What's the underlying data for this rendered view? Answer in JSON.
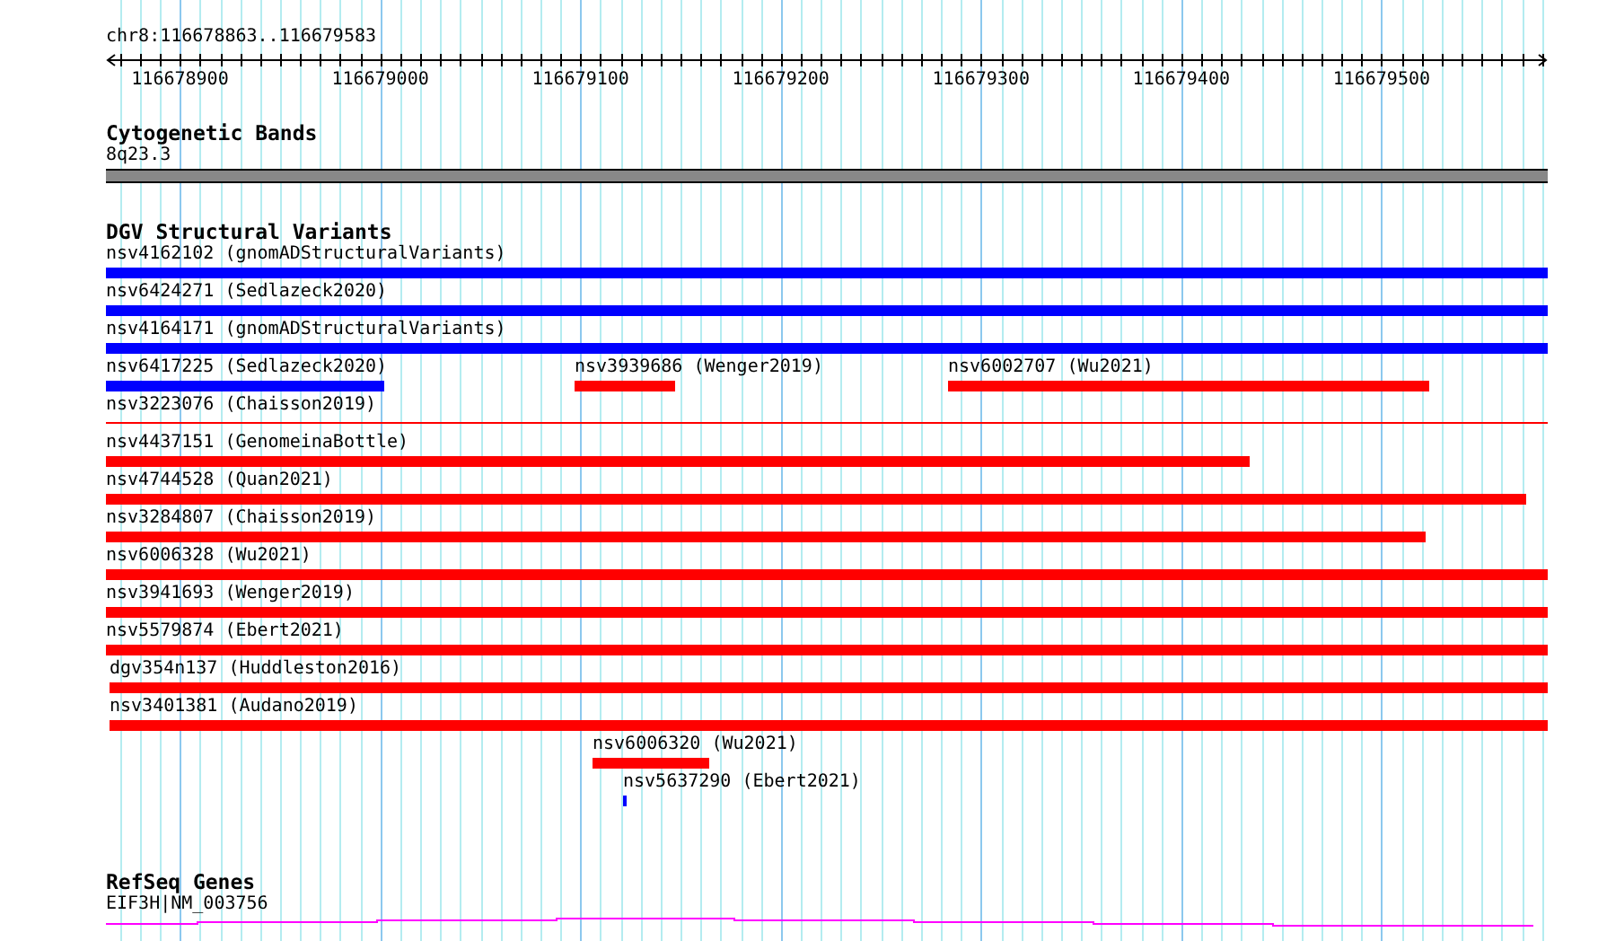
{
  "location": "chr8:116678863..116679583",
  "ruler": {
    "ticks": [
      "116678900",
      "116679000",
      "116679100",
      "116679200",
      "116679300",
      "116679400",
      "116679500"
    ]
  },
  "tracks": [
    {
      "kind": "bands",
      "title": "Cytogenetic Bands",
      "label": "8q23.3"
    },
    {
      "kind": "variants",
      "title": "DGV Structural Variants",
      "rows": [
        {
          "features": [
            {
              "kind": "bar",
              "label": "nsv4162102 (gnomADStructuralVariants)",
              "color": "#0000ff"
            }
          ]
        },
        {
          "features": [
            {
              "kind": "bar",
              "label": "nsv6424271 (Sedlazeck2020)",
              "color": "#0000ff"
            }
          ]
        },
        {
          "features": [
            {
              "kind": "bar",
              "label": "nsv4164171 (gnomADStructuralVariants)",
              "color": "#0000ff"
            }
          ]
        },
        {
          "features": [
            {
              "kind": "bar",
              "label": "nsv6417225 (Sedlazeck2020)",
              "color": "#0000ff"
            },
            {
              "kind": "bar",
              "label": "nsv3939686 (Wenger2019)",
              "color": "#ff0000"
            },
            {
              "kind": "bar",
              "label": "nsv6002707 (Wu2021)",
              "color": "#ff0000"
            }
          ]
        },
        {
          "features": [
            {
              "kind": "thin",
              "label": "nsv3223076 (Chaisson2019)",
              "color": "#ff0000"
            }
          ]
        },
        {
          "features": [
            {
              "kind": "bar",
              "label": "nsv4437151 (GenomeinaBottle)",
              "color": "#ff0000"
            }
          ]
        },
        {
          "features": [
            {
              "kind": "bar",
              "label": "nsv4744528 (Quan2021)",
              "color": "#ff0000"
            }
          ]
        },
        {
          "features": [
            {
              "kind": "bar",
              "label": "nsv3284807 (Chaisson2019)",
              "color": "#ff0000"
            }
          ]
        },
        {
          "features": [
            {
              "kind": "bar",
              "label": "nsv6006328 (Wu2021)",
              "color": "#ff0000"
            }
          ]
        },
        {
          "features": [
            {
              "kind": "bar",
              "label": "nsv3941693 (Wenger2019)",
              "color": "#ff0000"
            }
          ]
        },
        {
          "features": [
            {
              "kind": "bar",
              "label": "nsv5579874 (Ebert2021)",
              "color": "#ff0000"
            }
          ]
        },
        {
          "features": [
            {
              "kind": "bar",
              "label": "dgv354n137 (Huddleston2016)",
              "color": "#ff0000"
            }
          ]
        },
        {
          "features": [
            {
              "kind": "bar",
              "label": "nsv3401381 (Audano2019)",
              "color": "#ff0000"
            }
          ]
        },
        {
          "features": [
            {
              "kind": "bar",
              "label": "nsv6006320 (Wu2021)",
              "color": "#ff0000"
            }
          ]
        },
        {
          "features": [
            {
              "kind": "bar",
              "label": "nsv5637290 (Ebert2021)",
              "color": "#0000ff"
            }
          ]
        }
      ]
    },
    {
      "kind": "genes",
      "title": "RefSeq Genes",
      "label": "EIF3H|NM_003756"
    }
  ]
}
